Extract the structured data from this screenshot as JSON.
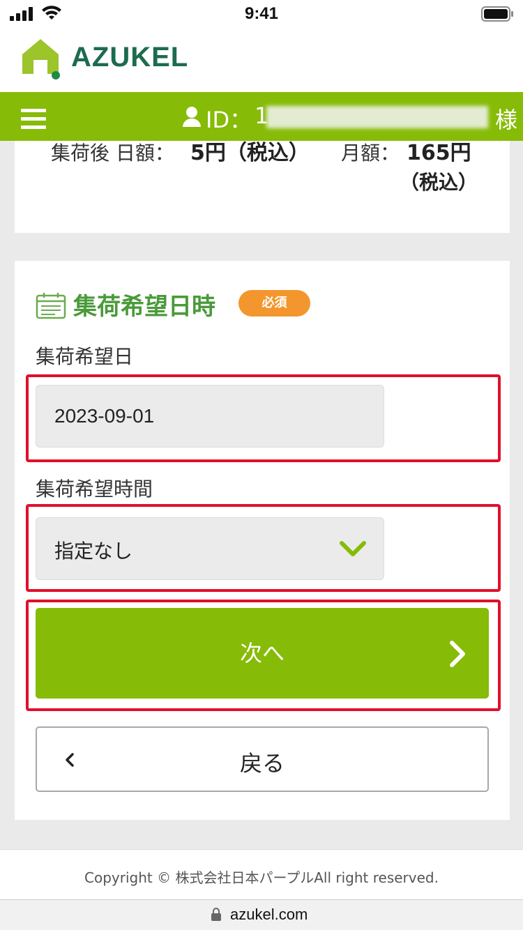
{
  "status_bar": {
    "time": "9:41"
  },
  "header": {
    "logo_text": "AZUKEL"
  },
  "nav": {
    "id_label": "ID：",
    "id_value_visible": "1",
    "honorific": "様"
  },
  "fee": {
    "daily_label": "集荷後 日額：",
    "daily_value": "5円（税込）",
    "monthly_label": "月額：",
    "monthly_value": "165円",
    "monthly_tax": "（税込）"
  },
  "pickup": {
    "section_title": "集荷希望日時",
    "required_badge": "必須",
    "date_label": "集荷希望日",
    "date_value": "2023-09-01",
    "time_label": "集荷希望時間",
    "time_value": "指定なし",
    "next_label": "次へ",
    "back_label": "戻る"
  },
  "footer": {
    "copyright": "Copyright © 株式会社日本パープルAll right reserved."
  },
  "browser": {
    "url": "azukel.com"
  },
  "colors": {
    "brand_green": "#86bb07",
    "logo_green": "#1d6b4f",
    "required_orange": "#f3962d",
    "highlight_red": "#e0102c"
  }
}
